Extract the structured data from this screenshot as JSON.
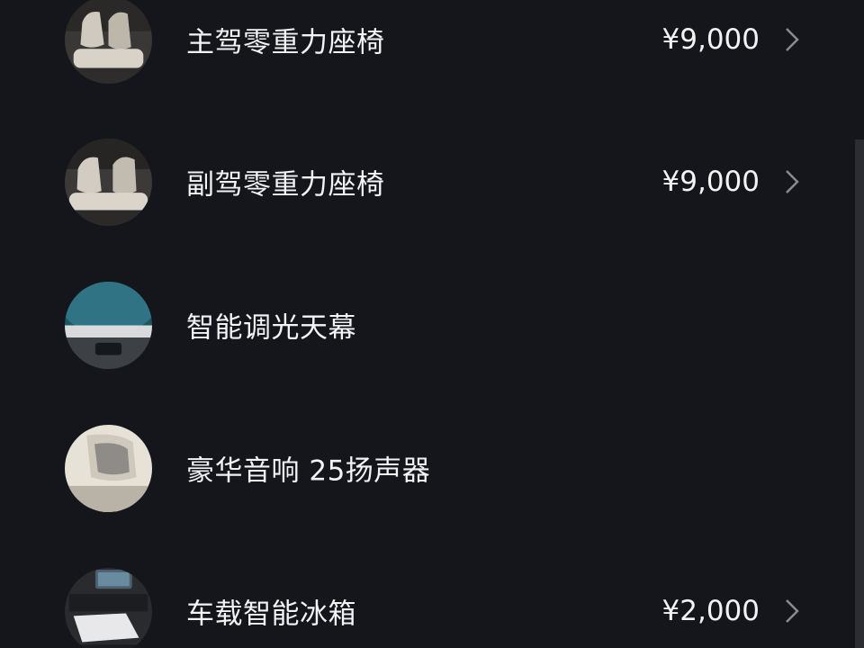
{
  "options": [
    {
      "label": "主驾零重力座椅",
      "price": "¥9,000",
      "icon": "driver-seat-thumbnail"
    },
    {
      "label": "副驾零重力座椅",
      "price": "¥9,000",
      "icon": "passenger-seat-thumbnail"
    },
    {
      "label": "智能调光天幕",
      "price": "",
      "icon": "sunroof-thumbnail"
    },
    {
      "label": "豪华音响 25扬声器",
      "price": "",
      "icon": "speaker-thumbnail"
    },
    {
      "label": "车载智能冰箱",
      "price": "¥2,000",
      "icon": "fridge-thumbnail"
    }
  ],
  "colors": {
    "background": "#15161b",
    "text": "#f2f3f5",
    "chevron": "#8a8b90",
    "scrollbar": "#2c2d33"
  }
}
